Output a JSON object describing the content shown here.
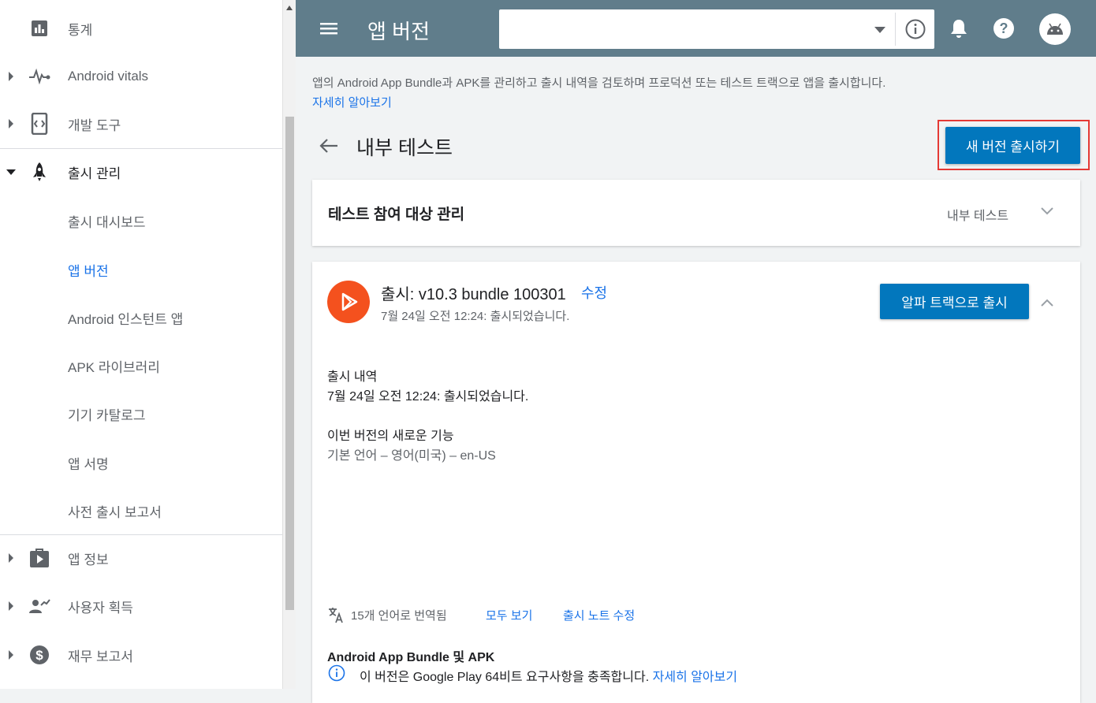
{
  "sidebar": {
    "items": [
      {
        "label": "통계"
      },
      {
        "label": "Android vitals"
      },
      {
        "label": "개발 도구"
      },
      {
        "label": "출시 관리"
      },
      {
        "label": "출시 대시보드"
      },
      {
        "label": "앱 버전"
      },
      {
        "label": "Android 인스턴트 앱"
      },
      {
        "label": "APK 라이브러리"
      },
      {
        "label": "기기 카탈로그"
      },
      {
        "label": "앱 서명"
      },
      {
        "label": "사전 출시 보고서"
      },
      {
        "label": "앱 정보"
      },
      {
        "label": "사용자 획득"
      },
      {
        "label": "재무 보고서"
      }
    ],
    "active_item": "앱 버전"
  },
  "topbar": {
    "title": "앱 버전",
    "app_select_value": ""
  },
  "main": {
    "intro_text": "앱의 Android App Bundle과 APK를 관리하고 출시 내역을 검토하며 프로덕션 또는 테스트 트랙으로 앱을 출시합니다.",
    "intro_link": "자세히 알아보기",
    "page_title": "내부 테스트",
    "new_release_button": "새 버전 출시하기",
    "testers_card": {
      "title": "테스트 참여 대상 관리",
      "track": "내부 테스트"
    },
    "release_card": {
      "title": "출시: v10.3 bundle 100301",
      "edit_link": "수정",
      "date": "7월 24일 오전 12:24: 출시되었습니다.",
      "alpha_button": "알파 트랙으로 출시",
      "history_title": "출시 내역",
      "history_text": "7월 24일 오전 12:24: 출시되었습니다.",
      "whats_new_title": "이번 버전의 새로운 기능",
      "whats_new_text": "기본 언어 – 영어(미국) – en-US",
      "translations_text": "15개 언어로 번역됨",
      "view_all_link": "모두 보기",
      "edit_notes_link": "출시 노트 수정",
      "bundle_title": "Android App Bundle 및 APK",
      "bundle_text": "이 버전은 Google Play 64비트 요구사항을 충족합니다.",
      "bundle_link": "자세히 알아보기"
    }
  },
  "colors": {
    "topbar": "#607d8b",
    "primary_button": "#0277bd",
    "link": "#1a73e8",
    "release_logo": "#f4511e",
    "highlight_border": "#e53935"
  }
}
